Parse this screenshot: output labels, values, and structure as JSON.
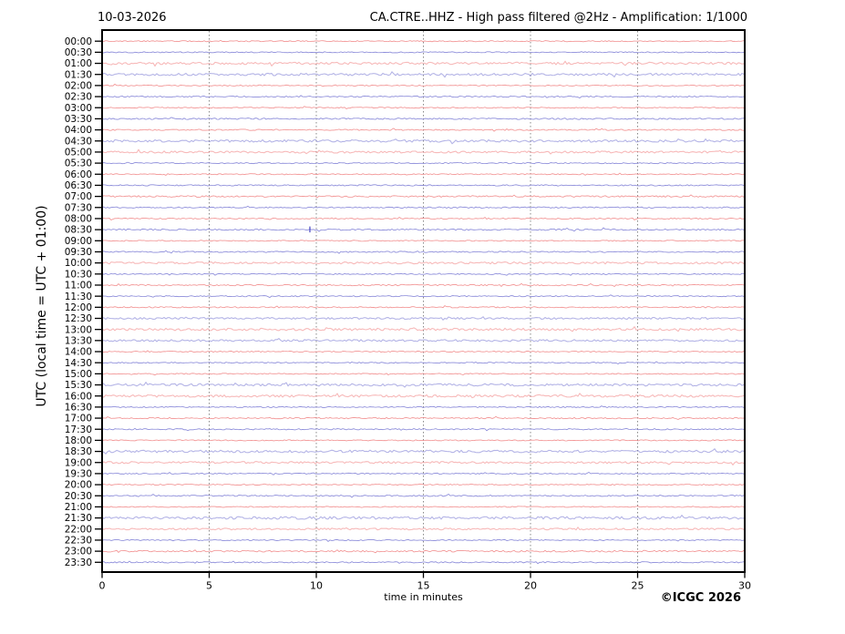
{
  "header": {
    "date": "10-03-2026",
    "title": "CA.CTRE..HHZ - High pass filtered @2Hz - Amplification: 1/1000"
  },
  "footer": {
    "copyright": "©ICGC 2026"
  },
  "axes": {
    "x": {
      "label": "time in minutes",
      "min": 0,
      "max": 30,
      "ticks": [
        0,
        5,
        10,
        15,
        20,
        25,
        30
      ],
      "grid_minutes": [
        5,
        10,
        15,
        20,
        25
      ]
    },
    "y": {
      "label": "UTC (local time = UTC + 01:00)"
    }
  },
  "colors": {
    "trace_red": "#f08080",
    "trace_blue": "#7676d2",
    "grid": "#8a8a8a",
    "axis": "#000000",
    "event": "#4040c0",
    "text": "#000000",
    "background": "#ffffff"
  },
  "chart_data": {
    "type": "line",
    "subtype": "helicorder-seismogram",
    "title": "CA.CTRE..HHZ - High pass filtered @2Hz - Amplification: 1/1000",
    "date": "10-03-2026",
    "xlabel": "time in minutes",
    "ylabel": "UTC (local time = UTC + 01:00)",
    "xlim": [
      0,
      30
    ],
    "x_ticks": [
      0,
      5,
      10,
      15,
      20,
      25,
      30
    ],
    "grid": "dotted vertical gridlines every 5 minutes",
    "legend": "none; each row is a 30-minute trace, colors alternate red/blue, amplitudes are background noise level (relative units)",
    "rows": [
      {
        "time": "00:00",
        "color": "red",
        "amp": 0.6
      },
      {
        "time": "00:30",
        "color": "blue",
        "amp": 0.6
      },
      {
        "time": "01:00",
        "color": "red",
        "amp": 1.2
      },
      {
        "time": "01:30",
        "color": "blue",
        "amp": 1.3
      },
      {
        "time": "02:00",
        "color": "red",
        "amp": 0.6
      },
      {
        "time": "02:30",
        "color": "blue",
        "amp": 0.7
      },
      {
        "time": "03:00",
        "color": "red",
        "amp": 0.6
      },
      {
        "time": "03:30",
        "color": "blue",
        "amp": 0.8
      },
      {
        "time": "04:00",
        "color": "red",
        "amp": 0.7
      },
      {
        "time": "04:30",
        "color": "blue",
        "amp": 1.3
      },
      {
        "time": "05:00",
        "color": "red",
        "amp": 1.1
      },
      {
        "time": "05:30",
        "color": "blue",
        "amp": 0.6
      },
      {
        "time": "06:00",
        "color": "red",
        "amp": 0.6
      },
      {
        "time": "06:30",
        "color": "blue",
        "amp": 0.7
      },
      {
        "time": "07:00",
        "color": "red",
        "amp": 0.9
      },
      {
        "time": "07:30",
        "color": "blue",
        "amp": 0.7
      },
      {
        "time": "08:00",
        "color": "red",
        "amp": 0.6
      },
      {
        "time": "08:30",
        "color": "blue",
        "amp": 0.8
      },
      {
        "time": "09:00",
        "color": "red",
        "amp": 0.6
      },
      {
        "time": "09:30",
        "color": "blue",
        "amp": 0.7
      },
      {
        "time": "10:00",
        "color": "red",
        "amp": 1.1
      },
      {
        "time": "10:30",
        "color": "blue",
        "amp": 0.6
      },
      {
        "time": "11:00",
        "color": "red",
        "amp": 0.7
      },
      {
        "time": "11:30",
        "color": "blue",
        "amp": 0.6
      },
      {
        "time": "12:00",
        "color": "red",
        "amp": 0.7
      },
      {
        "time": "12:30",
        "color": "blue",
        "amp": 1.0
      },
      {
        "time": "13:00",
        "color": "red",
        "amp": 1.3
      },
      {
        "time": "13:30",
        "color": "blue",
        "amp": 1.1
      },
      {
        "time": "14:00",
        "color": "red",
        "amp": 0.6
      },
      {
        "time": "14:30",
        "color": "blue",
        "amp": 0.6
      },
      {
        "time": "15:00",
        "color": "red",
        "amp": 0.6
      },
      {
        "time": "15:30",
        "color": "blue",
        "amp": 1.3
      },
      {
        "time": "16:00",
        "color": "red",
        "amp": 1.3
      },
      {
        "time": "16:30",
        "color": "blue",
        "amp": 0.6
      },
      {
        "time": "17:00",
        "color": "red",
        "amp": 0.7
      },
      {
        "time": "17:30",
        "color": "blue",
        "amp": 0.7
      },
      {
        "time": "18:00",
        "color": "red",
        "amp": 0.6
      },
      {
        "time": "18:30",
        "color": "blue",
        "amp": 1.4
      },
      {
        "time": "19:00",
        "color": "red",
        "amp": 1.1
      },
      {
        "time": "19:30",
        "color": "blue",
        "amp": 0.6
      },
      {
        "time": "20:00",
        "color": "red",
        "amp": 0.6
      },
      {
        "time": "20:30",
        "color": "blue",
        "amp": 0.7
      },
      {
        "time": "21:00",
        "color": "red",
        "amp": 0.6
      },
      {
        "time": "21:30",
        "color": "blue",
        "amp": 1.4
      },
      {
        "time": "22:00",
        "color": "red",
        "amp": 1.0
      },
      {
        "time": "22:30",
        "color": "blue",
        "amp": 0.6
      },
      {
        "time": "23:00",
        "color": "red",
        "amp": 0.9
      },
      {
        "time": "23:30",
        "color": "blue",
        "amp": 0.7
      }
    ],
    "events": [
      {
        "time": "08:30",
        "minute": 9.7,
        "note": "small spike on trace"
      }
    ]
  }
}
